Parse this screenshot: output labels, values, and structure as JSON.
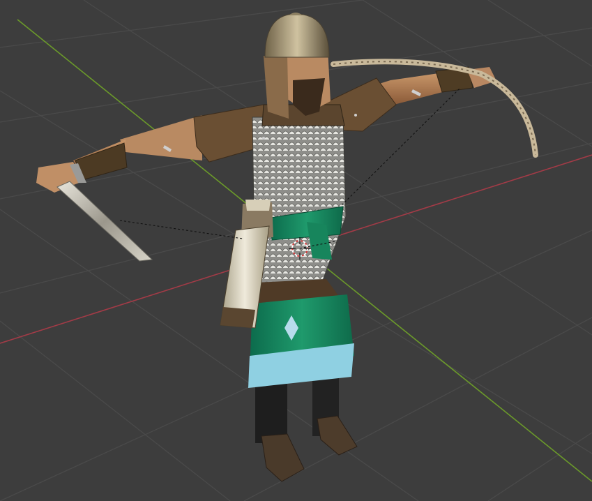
{
  "viewport": {
    "background": "#3d3d3d",
    "grid_color": "#4a4a4a",
    "x_axis_color": "#a33b47",
    "y_axis_color": "#6b9a2a",
    "show_grid": true,
    "show_x_axis": true,
    "show_y_axis": true
  },
  "scene": {
    "object": "character-model",
    "pose": "T-pose",
    "held_items": [
      "sword",
      "bow"
    ],
    "shading": "textured",
    "armature_visible": true
  },
  "overlays": {
    "origin_marker": "3d-cursor-icon",
    "relationship_lines": "dashed"
  }
}
